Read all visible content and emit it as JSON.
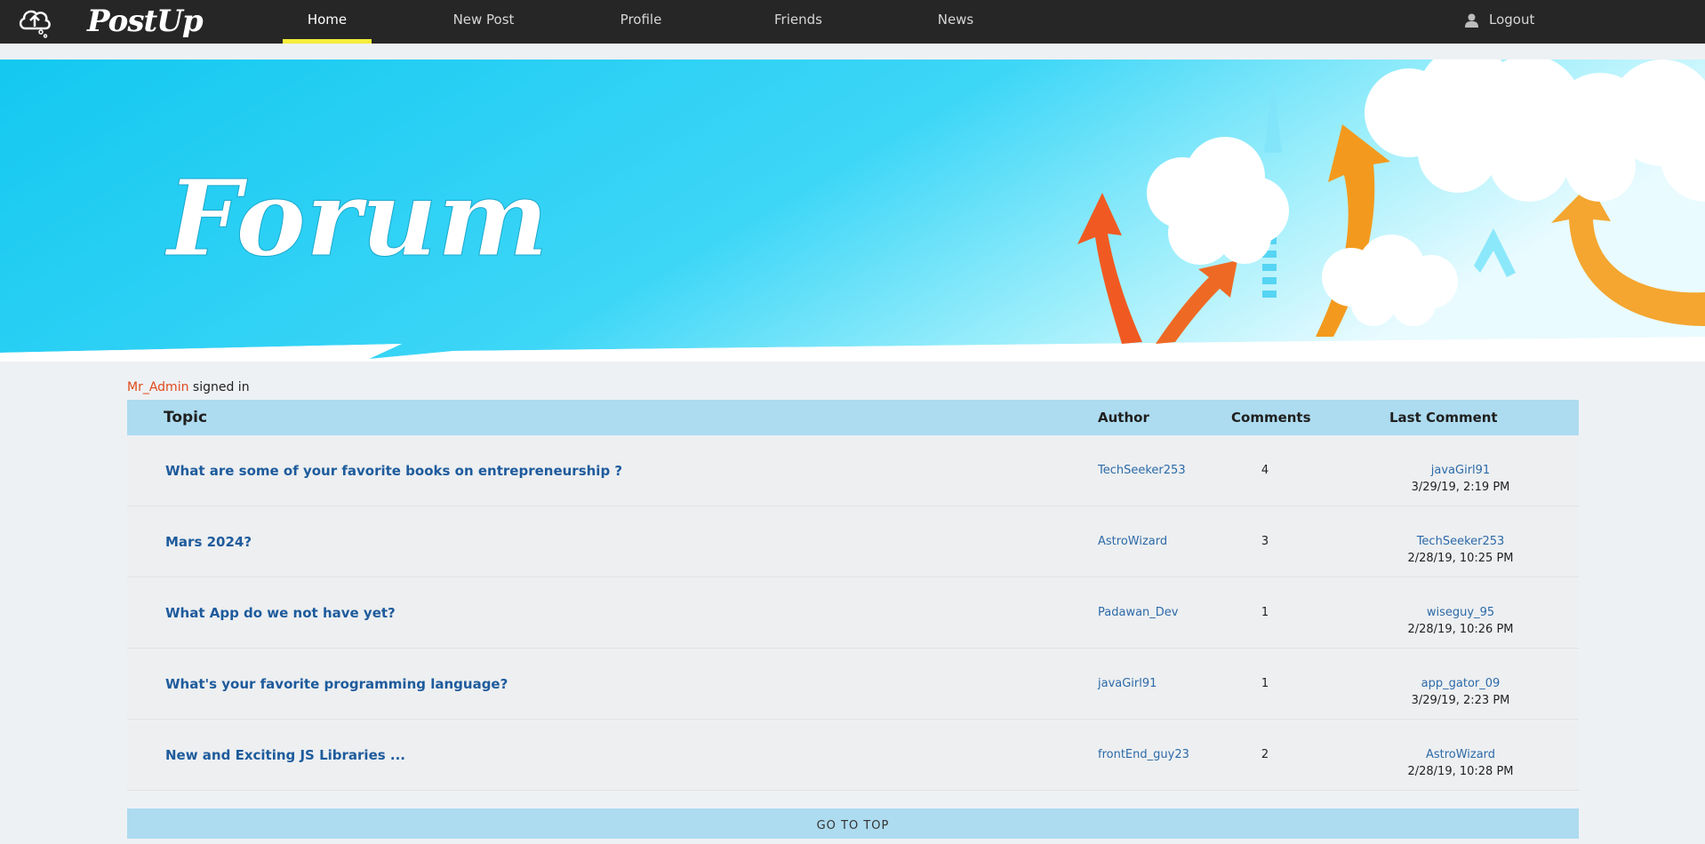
{
  "navbar": {
    "brand": "PostUp",
    "items": [
      {
        "label": "Home"
      },
      {
        "label": "New Post"
      },
      {
        "label": "Profile"
      },
      {
        "label": "Friends"
      },
      {
        "label": "News"
      }
    ],
    "logout": "Logout"
  },
  "banner": {
    "title": "Forum"
  },
  "signed_in": {
    "username": "Mr_Admin",
    "suffix": "signed in"
  },
  "table": {
    "headers": {
      "topic": "Topic",
      "author": "Author",
      "comments": "Comments",
      "last": "Last Comment"
    },
    "rows": [
      {
        "topic": "What are some of your favorite books on entrepreneurship ?",
        "author": "TechSeeker253",
        "comments": "4",
        "last_user": "javaGirl91",
        "last_date": "3/29/19, 2:19 PM"
      },
      {
        "topic": "Mars 2024?",
        "author": "AstroWizard",
        "comments": "3",
        "last_user": "TechSeeker253",
        "last_date": "2/28/19, 10:25 PM"
      },
      {
        "topic": "What App do we not have yet?",
        "author": "Padawan_Dev",
        "comments": "1",
        "last_user": "wiseguy_95",
        "last_date": "2/28/19, 10:26 PM"
      },
      {
        "topic": "What's your favorite programming language?",
        "author": "javaGirl91",
        "comments": "1",
        "last_user": "app_gator_09",
        "last_date": "3/29/19, 2:23 PM"
      },
      {
        "topic": "New and Exciting JS Libraries ...",
        "author": "frontEnd_guy23",
        "comments": "2",
        "last_user": "AstroWizard",
        "last_date": "2/28/19, 10:28 PM"
      }
    ]
  },
  "go_top": "GO TO TOP",
  "colors": {
    "navbar": "#262626",
    "active_underline": "#f5ec3a",
    "header_blue": "#addbf0",
    "link_blue": "#1e5b9c",
    "username_orange": "#e0491b"
  }
}
